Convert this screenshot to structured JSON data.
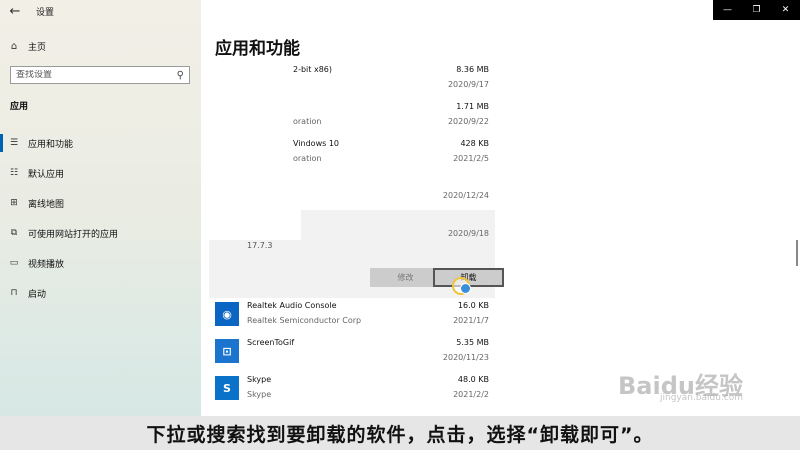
{
  "window": {
    "title": "设置",
    "back_icon": "←",
    "controls": {
      "minimize": "—",
      "maximize": "❐",
      "close": "✕"
    }
  },
  "sidebar": {
    "home": {
      "icon": "⌂",
      "label": "主页"
    },
    "search": {
      "placeholder": "查找设置",
      "icon": "⚲"
    },
    "section_title": "应用",
    "items": [
      {
        "icon": "☰",
        "label": "应用和功能",
        "active": true
      },
      {
        "icon": "☷",
        "label": "默认应用"
      },
      {
        "icon": "⊞",
        "label": "离线地图"
      },
      {
        "icon": "⧉",
        "label": "可使用网站打开的应用"
      },
      {
        "icon": "▭",
        "label": "视频播放"
      },
      {
        "icon": "⊓",
        "label": "启动"
      }
    ]
  },
  "main": {
    "title": "应用和功能",
    "apps": [
      {
        "name": "2-bit x86)",
        "publisher": "",
        "size": "8.36 MB",
        "date": "2020/9/17"
      },
      {
        "name": "",
        "publisher": "oration",
        "size": "1.71 MB",
        "date": "2020/9/22"
      },
      {
        "name": "Vindows 10",
        "publisher": "oration",
        "size": "428 KB",
        "date": "2021/2/5"
      },
      {
        "name": "",
        "publisher": "",
        "size": "",
        "date": "2020/12/24"
      }
    ],
    "selected": {
      "date": "2020/9/18",
      "version": "17.7.3",
      "modify_label": "修改",
      "uninstall_label": "卸载"
    },
    "apps_after": [
      {
        "name": "Realtek Audio Console",
        "publisher": "Realtek Semiconductor Corp",
        "size": "16.0 KB",
        "date": "2021/1/7",
        "icon_color": "#0b65c2",
        "icon_glyph": "◉"
      },
      {
        "name": "ScreenToGif",
        "publisher": "",
        "size": "5.35 MB",
        "date": "2020/11/23",
        "icon_color": "#1b75cf",
        "icon_glyph": "⊡"
      },
      {
        "name": "Skype",
        "publisher": "Skype",
        "size": "48.0 KB",
        "date": "2021/2/2",
        "icon_color": "#0a73c9",
        "icon_glyph": "S"
      }
    ]
  },
  "watermark": {
    "text": "Baidu经验",
    "sub": "jingyan.baidu.com"
  },
  "caption": "下拉或搜索找到要卸载的软件，点击，选择“卸载即可”。"
}
